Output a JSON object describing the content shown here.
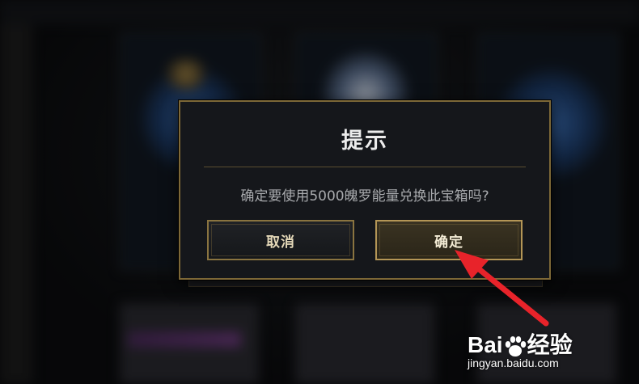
{
  "dialog": {
    "title": "提示",
    "message": "确定要使用5000魄罗能量兑换此宝箱吗?",
    "cancel_label": "取消",
    "confirm_label": "确定"
  },
  "watermark": {
    "brand_left": "Bai",
    "brand_right": "经验",
    "url": "jingyan.baidu.com"
  },
  "annotation": {
    "arrow_color": "#e8232a",
    "arrow_target": "confirm-button"
  },
  "colors": {
    "dialog_border": "#7d6837",
    "button_border": "#8a7440",
    "title_text": "#ececec",
    "message_text": "#a8aaad"
  }
}
